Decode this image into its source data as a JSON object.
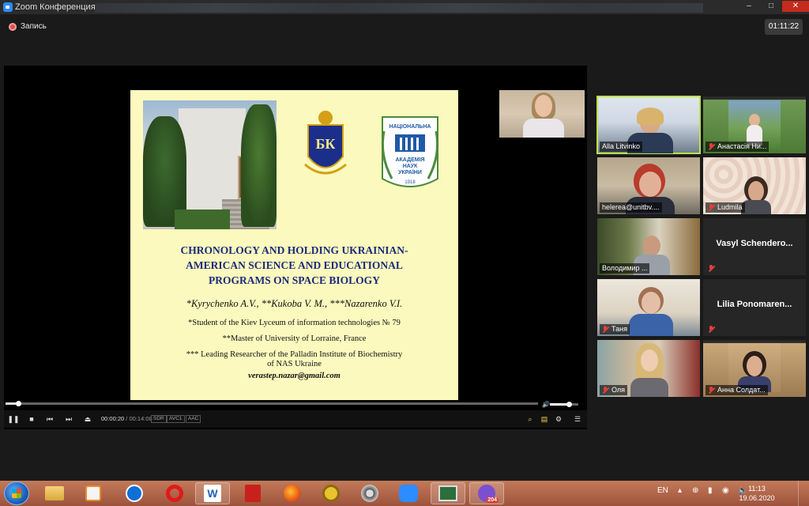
{
  "window": {
    "title": "Zoom Конференция",
    "min": "–",
    "max": "□",
    "close": "✕"
  },
  "recording": {
    "label": "Запись"
  },
  "timer": "01:11:22",
  "slide": {
    "title_lines": [
      "CHRONOLOGY AND HOLDING UKRAINIAN-",
      "AMERICAN SCIENCE AND EDUCATIONAL",
      "PROGRAMS ON SPACE BIOLOGY"
    ],
    "authors": "*Kyrychenko A.V., **Kukoba V. M., ***Nazarenko V.I.",
    "affil1": "*Student of the Kiev Lyceum of information technologies № 79",
    "affil2": "**Master of University of Lorraine, France",
    "affil3a": "*** Leading Researcher of the Palladin Institute of Biochemistry",
    "affil3b": "of NAS Ukraine",
    "email": "verastep.nazar@gmail.com",
    "seal_text_top": "НАЦІОНАЛЬНА",
    "seal_text_mid": "АКАДЕМІЯ",
    "seal_text_mid2": "НАУК",
    "seal_text_bot": "УКРАЇНИ",
    "seal_year": "1918",
    "crest_letters": "БК"
  },
  "player": {
    "current": "00:00:20",
    "sep": " / ",
    "total": "00:14:08",
    "tags": [
      "SDR",
      "AVC1",
      "AAC"
    ],
    "seek_fraction": 0.024,
    "volume_fraction": 0.67
  },
  "gallery": [
    {
      "name": "Alla Litvinko",
      "muted": false,
      "active": true
    },
    {
      "name": "Анастасія Ни...",
      "muted": true
    },
    {
      "name": "helerea@unitbv....",
      "muted": false
    },
    {
      "name": "Ludmila",
      "muted": true
    },
    {
      "name": "Володимир ...",
      "muted": false
    },
    {
      "name": "Vasyl Schendero...",
      "muted": true,
      "no_video": true
    },
    {
      "name": "Таня",
      "muted": true
    },
    {
      "name": "Lilia Ponomaren...",
      "muted": true,
      "no_video": true
    },
    {
      "name": "Оля",
      "muted": true
    },
    {
      "name": "Анна Солдат...",
      "muted": true
    }
  ],
  "taskbar": {
    "apps": [
      "explorer-icon",
      "media-player-icon",
      "teamviewer-icon",
      "opera-icon",
      "word-icon",
      "acrobat-icon",
      "firefox-icon",
      "reel-icon",
      "film-icon",
      "zoom-icon",
      "presentation-icon",
      "viber-icon"
    ],
    "word_letter": "W",
    "viber_badge": "204",
    "lang": "EN",
    "time": "11:13",
    "date": "19.06.2020"
  }
}
